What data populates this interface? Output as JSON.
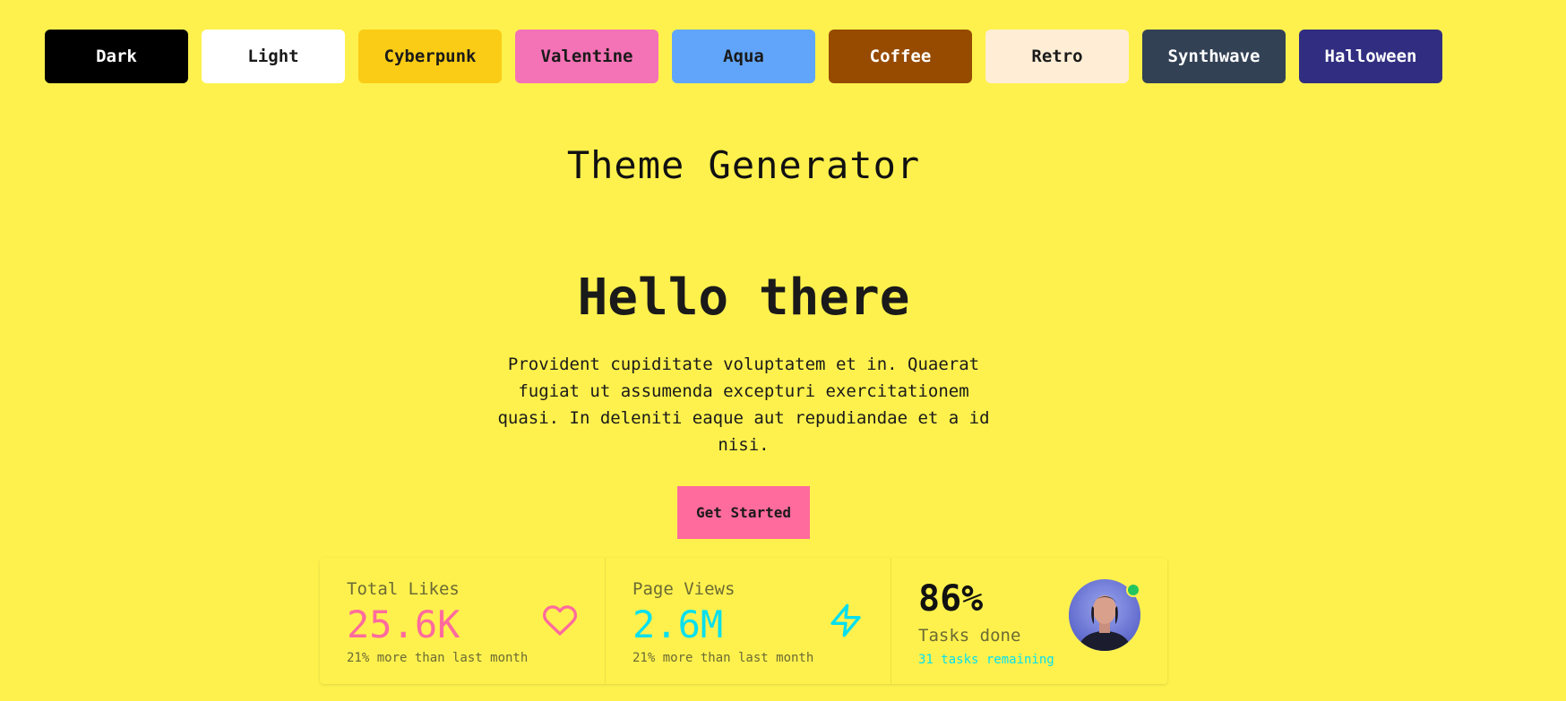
{
  "themes": [
    {
      "label": "Dark",
      "bg": "#000000",
      "fg": "#ffffff"
    },
    {
      "label": "Light",
      "bg": "#ffffff",
      "fg": "#1a1a1a"
    },
    {
      "label": "Cyberpunk",
      "bg": "#facc15",
      "fg": "#1a1a1a"
    },
    {
      "label": "Valentine",
      "bg": "#f472b6",
      "fg": "#1a1a1a"
    },
    {
      "label": "Aqua",
      "bg": "#60a5fa",
      "fg": "#1a1a1a"
    },
    {
      "label": "Coffee",
      "bg": "#964B00",
      "fg": "#ffffff"
    },
    {
      "label": "Retro",
      "bg": "#ffedd5",
      "fg": "#1a1a1a"
    },
    {
      "label": "Synthwave",
      "bg": "#334155",
      "fg": "#ffffff"
    },
    {
      "label": "Halloween",
      "bg": "#312e81",
      "fg": "#ffffff"
    }
  ],
  "page": {
    "title": "Theme Generator",
    "background": "#fef14d"
  },
  "hero": {
    "heading": "Hello there",
    "text": "Provident cupiditate voluptatem et in. Quaerat fugiat ut assumenda excepturi exercitationem quasi. In deleniti eaque aut repudiandae et a id nisi.",
    "cta_label": "Get Started"
  },
  "stats": {
    "likes": {
      "title": "Total Likes",
      "value": "25.6K",
      "desc": "21% more than last month",
      "color": "#ff6b9d",
      "icon": "heart-icon"
    },
    "views": {
      "title": "Page Views",
      "value": "2.6M",
      "desc": "21% more than last month",
      "color": "#06e0ee",
      "icon": "bolt-icon"
    },
    "tasks": {
      "value": "86%",
      "title": "Tasks done",
      "desc": "31 tasks remaining",
      "icon": "avatar"
    }
  }
}
